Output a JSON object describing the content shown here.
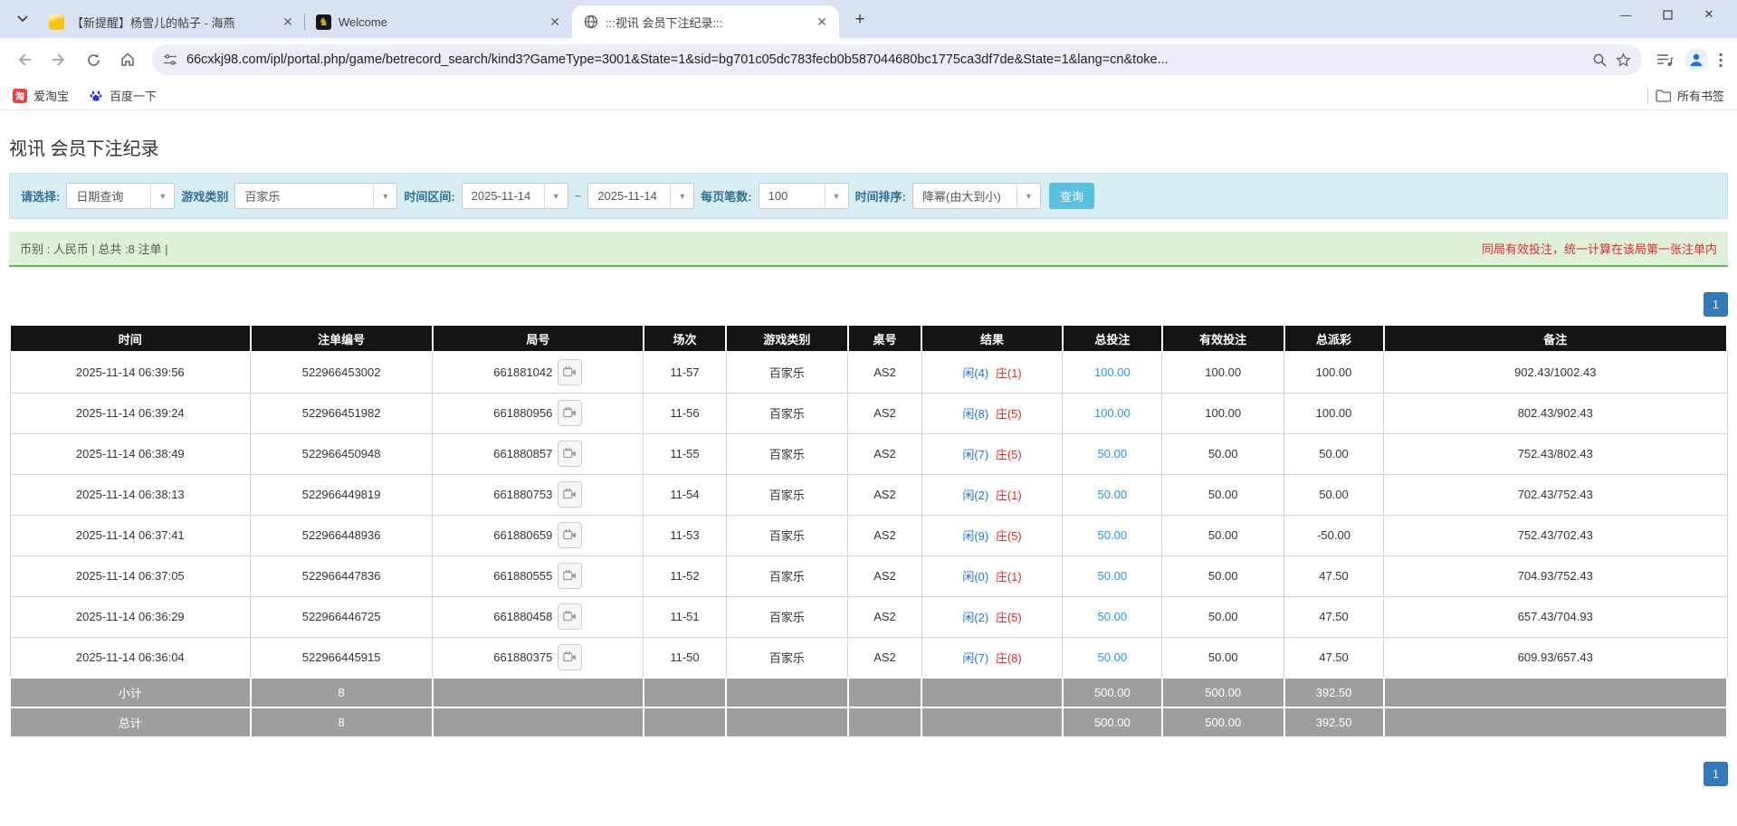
{
  "browser": {
    "tabs": [
      {
        "title": "【新提醒】杨雪儿的帖子 - 海燕",
        "icon": "forum-yellow"
      },
      {
        "title": "Welcome",
        "icon": "dark-gold-emblem"
      },
      {
        "title": ":::视讯 会员下注纪录:::",
        "icon": "globe"
      }
    ],
    "dark_tab_glyph": "♞",
    "url": "66cxkj98.com/ipl/portal.php/game/betrecord_search/kind3?GameType=3001&State=1&sid=bg701c05dc783fecb0b587044680bc1775ca3df7de&State=1&lang=cn&toke...",
    "bookmarks": [
      {
        "label": "爱淘宝",
        "glyph": "淘"
      },
      {
        "label": "百度一下",
        "glyph": "¨"
      }
    ],
    "all_bookmarks_label": "所有书签"
  },
  "page": {
    "title": "视讯 会员下注纪录",
    "filters": {
      "select_label": "请选择:",
      "select_value": "日期查询",
      "game_type_label": "游戏类别",
      "game_type_value": "百家乐",
      "date_range_label": "时间区间:",
      "date_from": "2025-11-14",
      "tilde": "~",
      "date_to": "2025-11-14",
      "page_size_label": "每页笔数:",
      "page_size_value": "100",
      "sort_label": "时间排序:",
      "sort_value": "降幂(由大到小)",
      "search_button": "查询",
      "arrow_glyph": "▼"
    },
    "status_bar": {
      "left": "币别 : 人民币 | 总共 :8 注单 |",
      "right": "同局有效投注，统一计算在该局第一张注单内"
    },
    "pagination": {
      "current_page": "1"
    },
    "table": {
      "headers": [
        "时间",
        "注单编号",
        "局号",
        "场次",
        "游戏类别",
        "桌号",
        "结果",
        "总投注",
        "有效投注",
        "总派彩",
        "备注"
      ],
      "rows": [
        {
          "time": "2025-11-14 06:39:56",
          "bet_id": "522966453002",
          "round_id": "661881042",
          "session": "11-57",
          "game": "百家乐",
          "table": "AS2",
          "result_player": "闲(4)",
          "result_banker": "庄(1)",
          "total_bet": "100.00",
          "valid_bet": "100.00",
          "payout": "100.00",
          "note": "902.43/1002.43"
        },
        {
          "time": "2025-11-14 06:39:24",
          "bet_id": "522966451982",
          "round_id": "661880956",
          "session": "11-56",
          "game": "百家乐",
          "table": "AS2",
          "result_player": "闲(8)",
          "result_banker": "庄(5)",
          "total_bet": "100.00",
          "valid_bet": "100.00",
          "payout": "100.00",
          "note": "802.43/902.43"
        },
        {
          "time": "2025-11-14 06:38:49",
          "bet_id": "522966450948",
          "round_id": "661880857",
          "session": "11-55",
          "game": "百家乐",
          "table": "AS2",
          "result_player": "闲(7)",
          "result_banker": "庄(5)",
          "total_bet": "50.00",
          "valid_bet": "50.00",
          "payout": "50.00",
          "note": "752.43/802.43"
        },
        {
          "time": "2025-11-14 06:38:13",
          "bet_id": "522966449819",
          "round_id": "661880753",
          "session": "11-54",
          "game": "百家乐",
          "table": "AS2",
          "result_player": "闲(2)",
          "result_banker": "庄(1)",
          "total_bet": "50.00",
          "valid_bet": "50.00",
          "payout": "50.00",
          "note": "702.43/752.43"
        },
        {
          "time": "2025-11-14 06:37:41",
          "bet_id": "522966448936",
          "round_id": "661880659",
          "session": "11-53",
          "game": "百家乐",
          "table": "AS2",
          "result_player": "闲(9)",
          "result_banker": "庄(5)",
          "total_bet": "50.00",
          "valid_bet": "50.00",
          "payout": "-50.00",
          "note": "752.43/702.43"
        },
        {
          "time": "2025-11-14 06:37:05",
          "bet_id": "522966447836",
          "round_id": "661880555",
          "session": "11-52",
          "game": "百家乐",
          "table": "AS2",
          "result_player": "闲(0)",
          "result_banker": "庄(1)",
          "total_bet": "50.00",
          "valid_bet": "50.00",
          "payout": "47.50",
          "note": "704.93/752.43"
        },
        {
          "time": "2025-11-14 06:36:29",
          "bet_id": "522966446725",
          "round_id": "661880458",
          "session": "11-51",
          "game": "百家乐",
          "table": "AS2",
          "result_player": "闲(2)",
          "result_banker": "庄(5)",
          "total_bet": "50.00",
          "valid_bet": "50.00",
          "payout": "47.50",
          "note": "657.43/704.93"
        },
        {
          "time": "2025-11-14 06:36:04",
          "bet_id": "522966445915",
          "round_id": "661880375",
          "session": "11-50",
          "game": "百家乐",
          "table": "AS2",
          "result_player": "闲(7)",
          "result_banker": "庄(8)",
          "total_bet": "50.00",
          "valid_bet": "50.00",
          "payout": "47.50",
          "note": "609.93/657.43"
        }
      ],
      "subtotal": {
        "label": "小计",
        "count": "8",
        "total_bet": "500.00",
        "valid_bet": "500.00",
        "payout": "392.50"
      },
      "total": {
        "label": "总计",
        "count": "8",
        "total_bet": "500.00",
        "valid_bet": "500.00",
        "payout": "392.50"
      }
    }
  }
}
